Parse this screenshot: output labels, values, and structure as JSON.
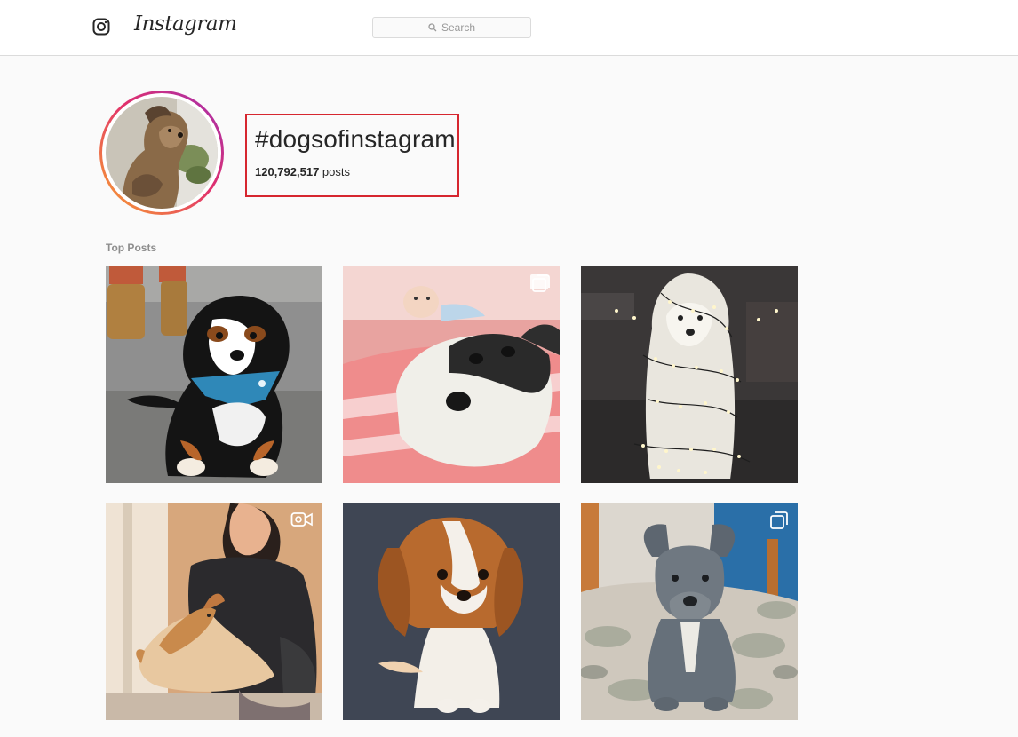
{
  "header": {
    "brand": "Instagram",
    "search_placeholder": "Search"
  },
  "hashtag": {
    "title": "#dogsofinstagram",
    "post_count": "120,792,517",
    "post_suffix": "posts"
  },
  "section": {
    "label": "Top Posts"
  },
  "posts": [
    {
      "subject": "bernese-puppy-with-blue-bandana",
      "badge": "none"
    },
    {
      "subject": "baby-and-husky-on-pink-blanket",
      "badge": "multiple-posts-icon"
    },
    {
      "subject": "white-dog-with-fairy-lights",
      "badge": "none"
    },
    {
      "subject": "woman-with-shiba-puppy",
      "badge": "video-icon"
    },
    {
      "subject": "cavalier-puppy",
      "badge": "none"
    },
    {
      "subject": "grey-pitbull-puppy",
      "badge": "multiple-posts-icon"
    }
  ],
  "colors": {
    "highlight_border": "#d6262f",
    "ring_start": "#f9a52e",
    "ring_mid": "#e1306c",
    "ring_end": "#a12fb3"
  }
}
